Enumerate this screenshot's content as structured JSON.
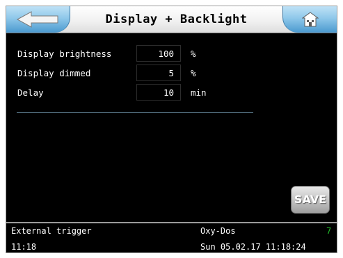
{
  "header": {
    "title": "Display + Backlight",
    "back_icon": "arrow-left-icon",
    "home_icon": "home-icon"
  },
  "settings": [
    {
      "label": "Display brightness",
      "value": "100",
      "unit": "%"
    },
    {
      "label": "Display dimmed",
      "value": "5",
      "unit": "%"
    },
    {
      "label": "Delay",
      "value": "10",
      "unit": "min"
    }
  ],
  "actions": {
    "save_label": "SAVE"
  },
  "status_bar": {
    "trigger": "External trigger",
    "device": "Oxy-Dos",
    "count": "7",
    "time": "11:18",
    "datetime": "Sun 05.02.17 11:18:24"
  },
  "colors": {
    "header_button": "#8fc8ea",
    "screen_background": "#000000",
    "status_count": "#22c22c",
    "divider": "#5d7d8f"
  }
}
